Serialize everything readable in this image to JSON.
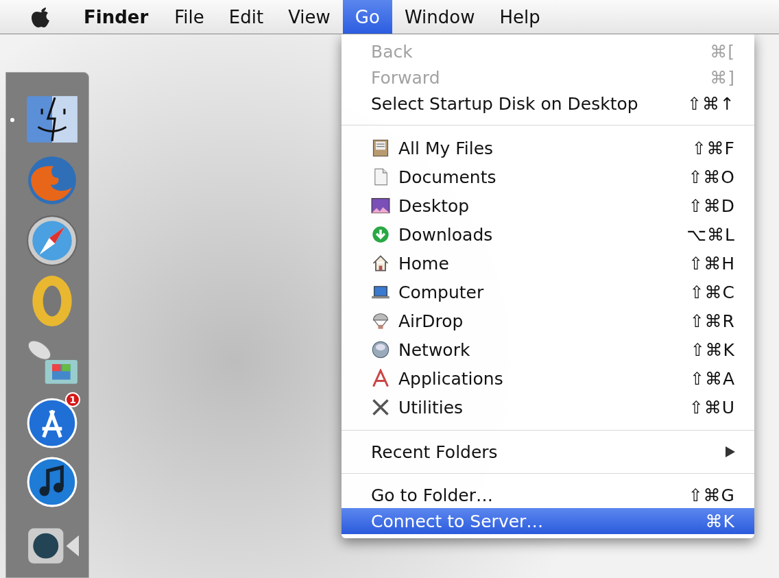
{
  "menu_bar": {
    "items": [
      {
        "label": "Finder",
        "kind": "app",
        "selected": false
      },
      {
        "label": "File",
        "kind": "menu",
        "selected": false
      },
      {
        "label": "Edit",
        "kind": "menu",
        "selected": false
      },
      {
        "label": "View",
        "kind": "menu",
        "selected": false
      },
      {
        "label": "Go",
        "kind": "menu",
        "selected": true
      },
      {
        "label": "Window",
        "kind": "menu",
        "selected": false
      },
      {
        "label": "Help",
        "kind": "menu",
        "selected": false
      }
    ]
  },
  "dock": {
    "items": [
      {
        "kind": "face",
        "running": true
      },
      {
        "kind": "fox-globe",
        "running": false
      },
      {
        "kind": "compass",
        "running": false
      },
      {
        "kind": "ring",
        "running": false
      },
      {
        "kind": "dish-monitor",
        "running": false
      },
      {
        "kind": "app-store",
        "running": false,
        "badge": "1"
      },
      {
        "kind": "music",
        "running": false
      },
      {
        "kind": "camera",
        "running": false
      }
    ]
  },
  "go_menu": {
    "sections": [
      [
        {
          "label": "Back",
          "shortcut": "⌘[",
          "kind": "plain",
          "disabled": true,
          "selected": false,
          "submenu": false
        },
        {
          "label": "Forward",
          "shortcut": "⌘]",
          "kind": "plain",
          "disabled": true,
          "selected": false,
          "submenu": false
        },
        {
          "label": "Select Startup Disk on Desktop",
          "shortcut": "⇧⌘↑",
          "kind": "plain",
          "disabled": false,
          "selected": false,
          "submenu": false
        }
      ],
      [
        {
          "label": "All My Files",
          "shortcut": "⇧⌘F",
          "kind": "drawer",
          "disabled": false,
          "selected": false,
          "submenu": false
        },
        {
          "label": "Documents",
          "shortcut": "⇧⌘O",
          "kind": "document",
          "disabled": false,
          "selected": false,
          "submenu": false
        },
        {
          "label": "Desktop",
          "shortcut": "⇧⌘D",
          "kind": "picture",
          "disabled": false,
          "selected": false,
          "submenu": false
        },
        {
          "label": "Downloads",
          "shortcut": "⌥⌘L",
          "kind": "download",
          "disabled": false,
          "selected": false,
          "submenu": false
        },
        {
          "label": "Home",
          "shortcut": "⇧⌘H",
          "kind": "house",
          "disabled": false,
          "selected": false,
          "submenu": false
        },
        {
          "label": "Computer",
          "shortcut": "⇧⌘C",
          "kind": "laptop",
          "disabled": false,
          "selected": false,
          "submenu": false
        },
        {
          "label": "AirDrop",
          "shortcut": "⇧⌘R",
          "kind": "parachute",
          "disabled": false,
          "selected": false,
          "submenu": false
        },
        {
          "label": "Network",
          "shortcut": "⇧⌘K",
          "kind": "globe",
          "disabled": false,
          "selected": false,
          "submenu": false
        },
        {
          "label": "Applications",
          "shortcut": "⇧⌘A",
          "kind": "letter-a",
          "disabled": false,
          "selected": false,
          "submenu": false
        },
        {
          "label": "Utilities",
          "shortcut": "⇧⌘U",
          "kind": "tools",
          "disabled": false,
          "selected": false,
          "submenu": false
        }
      ],
      [
        {
          "label": "Recent Folders",
          "kind": "plain",
          "disabled": false,
          "selected": false,
          "submenu": true
        }
      ],
      [
        {
          "label": "Go to Folder…",
          "shortcut": "⇧⌘G",
          "kind": "plain",
          "disabled": false,
          "selected": false,
          "submenu": false
        },
        {
          "label": "Connect to Server…",
          "shortcut": "⌘K",
          "kind": "plain",
          "disabled": false,
          "selected": true,
          "submenu": false
        }
      ]
    ]
  }
}
